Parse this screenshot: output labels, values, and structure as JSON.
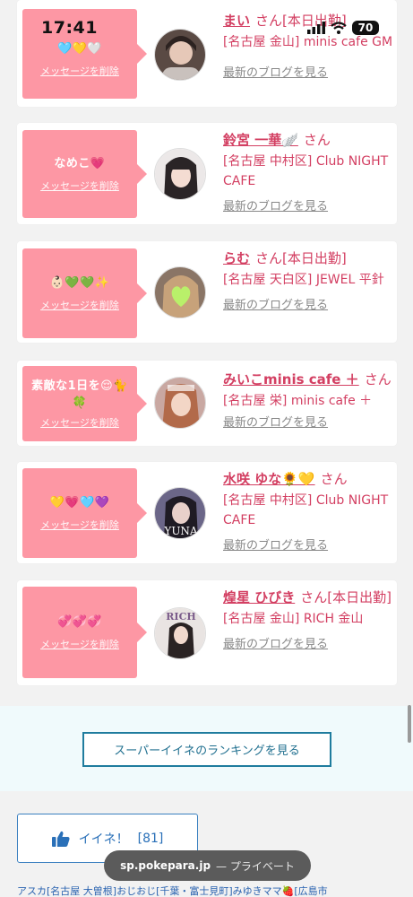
{
  "status_bar": {
    "time": "17:41",
    "battery": "70"
  },
  "cards": [
    {
      "message": "🩵💛🤍",
      "delete_label": "メッセージを削除",
      "name": "まい",
      "san": "さん",
      "extra": "[本日出勤]",
      "store": "[名古屋 金山] minis cafe GM",
      "blog_label": "最新のブログを見る"
    },
    {
      "message": "なめこ💗",
      "delete_label": "メッセージを削除",
      "name": "鈴宮 一華🪽",
      "san": "さん",
      "extra": "",
      "store": "[名古屋 中村区] Club NIGHT CAFE",
      "blog_label": "最新のブログを見る"
    },
    {
      "message": "👶🏻💚💚✨",
      "delete_label": "メッセージを削除",
      "name": "らむ",
      "san": "さん",
      "extra": "[本日出勤]",
      "store": "[名古屋 天白区] JEWEL 平針",
      "blog_label": "最新のブログを見る"
    },
    {
      "message": "素敵な1日を😌🐈🍀",
      "delete_label": "メッセージを削除",
      "name": "みいこminis cafe ＋",
      "san": "さん",
      "extra": "",
      "store": "[名古屋 栄] minis cafe ＋",
      "blog_label": "最新のブログを見る"
    },
    {
      "message": "💛💗🩵💜",
      "delete_label": "メッセージを削除",
      "name": "水咲 ゆな🌻💛",
      "san": "さん",
      "extra": "",
      "store": "[名古屋 中村区] Club NIGHT CAFE",
      "blog_label": "最新のブログを見る"
    },
    {
      "message": "💞💞💞",
      "delete_label": "メッセージを削除",
      "name": "煌星 ひびき",
      "san": "さん",
      "extra": "[本日出勤]",
      "store": "[名古屋 金山] RICH 金山",
      "blog_label": "最新のブログを見る"
    }
  ],
  "ranking_button": "スーパーイイネのランキングを見る",
  "like_button": {
    "label": "イイネ！",
    "count": "[81]"
  },
  "url_bar": {
    "host": "sp.pokepara.jp",
    "separator": "— プライベート"
  },
  "bottom_links": "アスカ[名古屋 大曽根]おじおじ[千葉・富士見町]みゆきママ🍓[広島市",
  "colors": {
    "bubble": "#fd97a4",
    "name": "#d33f62",
    "ranking_border": "#1f7c9e",
    "like_border": "#3a80c0"
  }
}
